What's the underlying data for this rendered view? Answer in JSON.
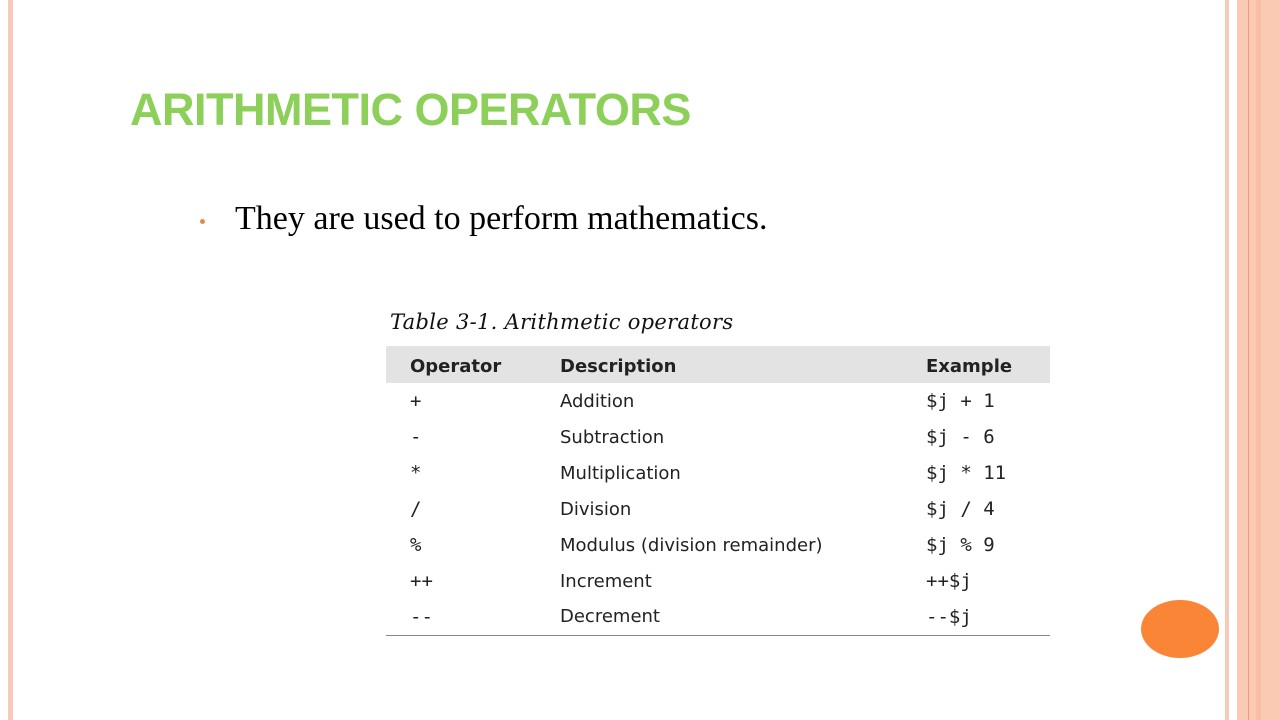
{
  "slide": {
    "title": "ARITHMETIC OPERATORS",
    "bullet": "They are used to perform mathematics.",
    "colors": {
      "title": "#8cd05a",
      "accent_orange": "#fb8537",
      "border_peach": "#fbcab3"
    }
  },
  "table": {
    "caption": "Table 3-1. Arithmetic operators",
    "headers": [
      "Operator",
      "Description",
      "Example"
    ],
    "rows": [
      {
        "operator": "+",
        "description": "Addition",
        "example": "$j + 1"
      },
      {
        "operator": "-",
        "description": "Subtraction",
        "example": "$j - 6"
      },
      {
        "operator": "*",
        "description": "Multiplication",
        "example": "$j * 11"
      },
      {
        "operator": "/",
        "description": "Division",
        "example": "$j / 4"
      },
      {
        "operator": "%",
        "description": "Modulus (division remainder)",
        "example": "$j % 9"
      },
      {
        "operator": "++",
        "description": "Increment",
        "example": "++$j"
      },
      {
        "operator": "--",
        "description": "Decrement",
        "example": "--$j"
      }
    ]
  }
}
